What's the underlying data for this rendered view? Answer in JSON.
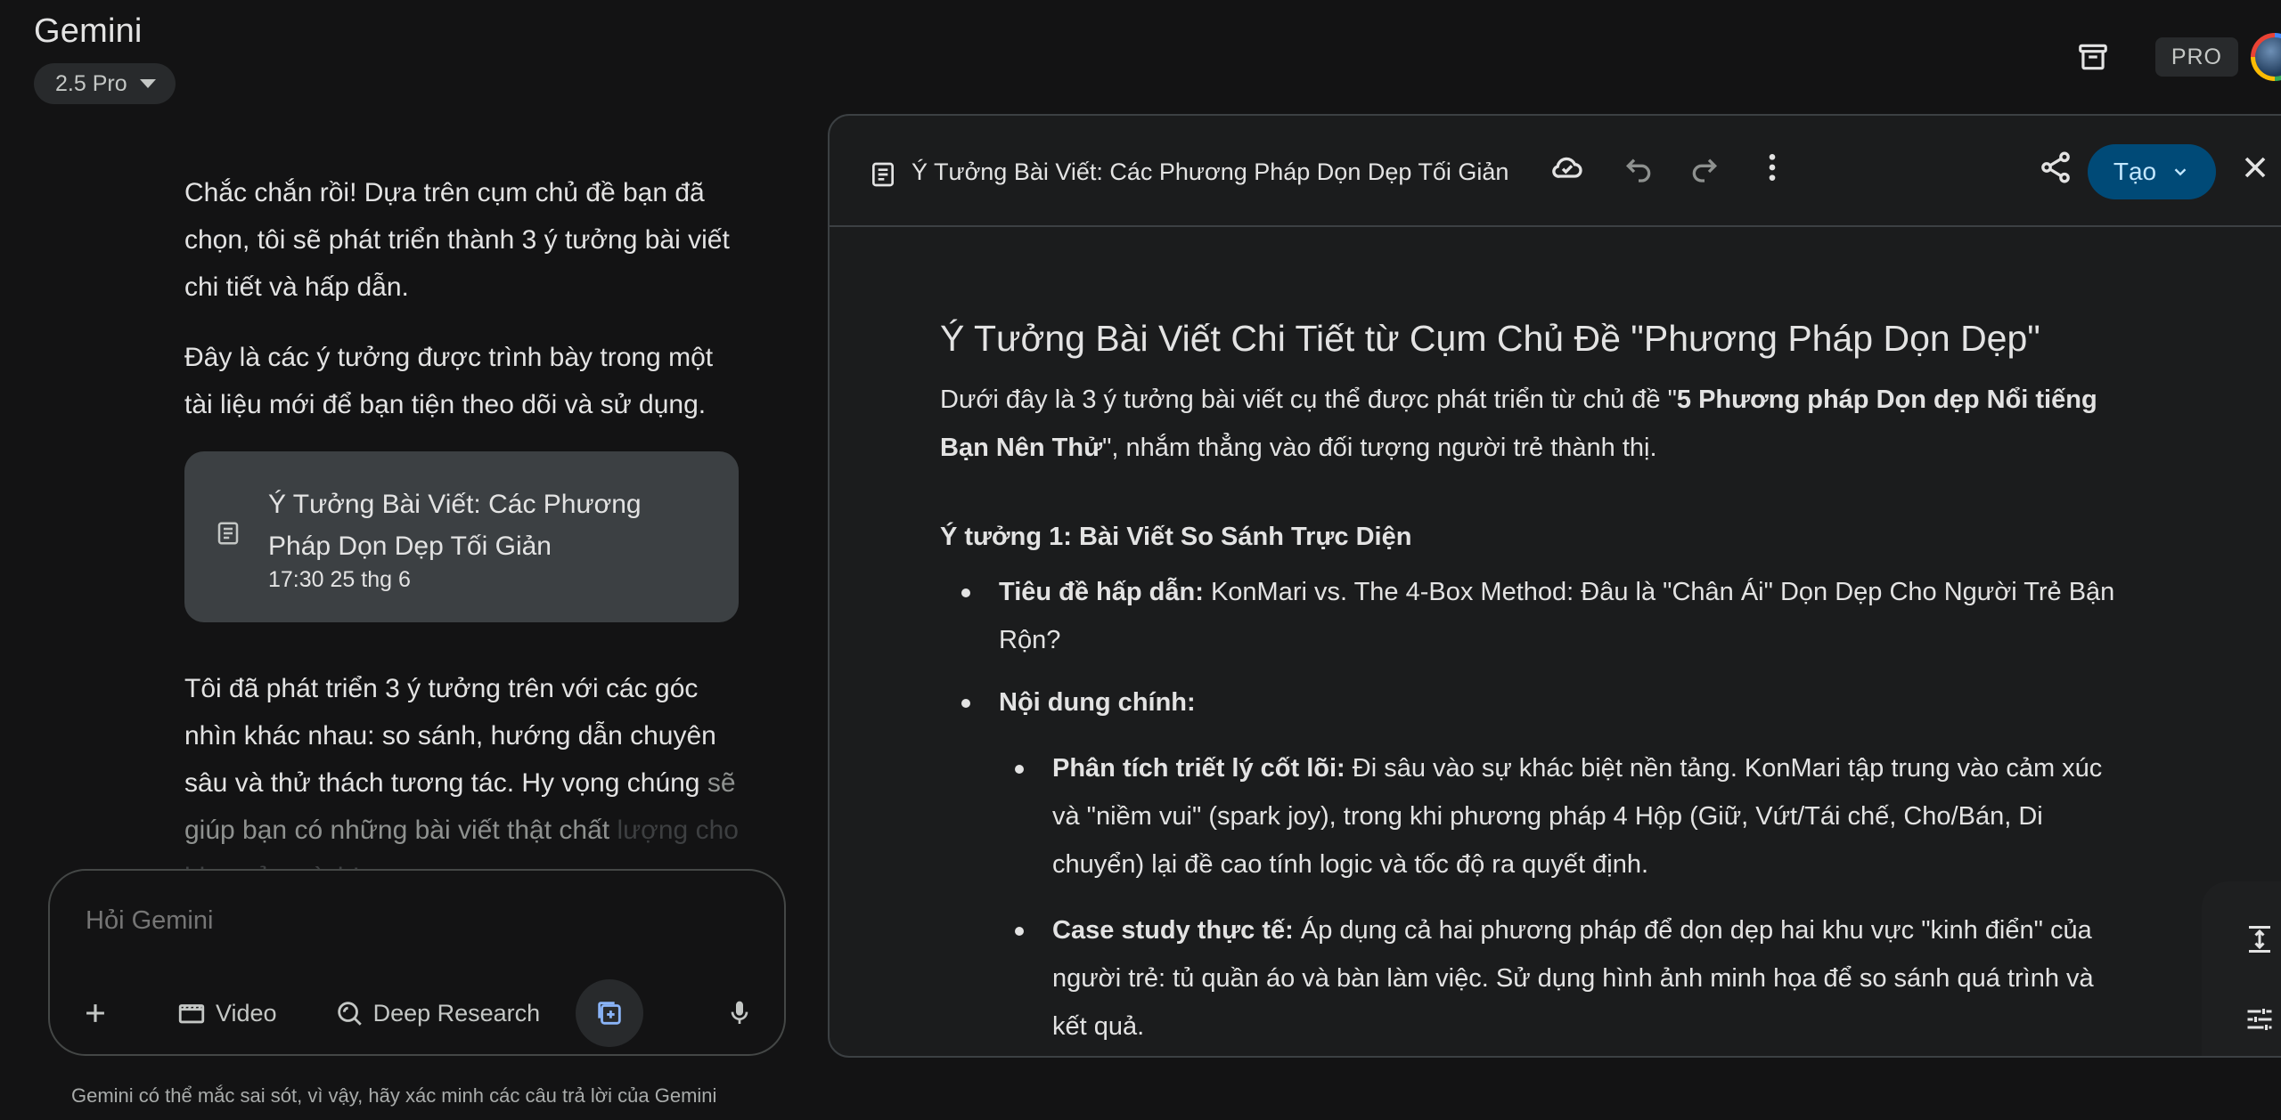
{
  "app": {
    "title": "Gemini"
  },
  "model": {
    "label": "2.5 Pro"
  },
  "header": {
    "pro_badge": "PRO"
  },
  "chat": {
    "para1": "Chắc chắn rồi! Dựa trên cụm chủ đề bạn đã chọn, tôi sẽ phát triển thành 3 ý tưởng bài viết chi tiết và hấp dẫn.",
    "para2": "Đây là các ý tưởng được trình bày trong một tài liệu mới để bạn tiện theo dõi và sử dụng.",
    "card_title": "Ý Tưởng Bài Viết: Các Phương Pháp Dọn Dẹp Tối Giản",
    "card_time": "17:30 25 thg 6",
    "para3": "Tôi đã phát triển 3 ý tưởng trên với các góc nhìn khác nhau: so sánh, hướng dẫn chuyên sâu và thử thách tương tác. Hy vọng chúng",
    "para3_fade": "sẽ giúp bạn có những bài viết thật chất",
    "para3_fade2": "lượng cho blog của mình!"
  },
  "prompt": {
    "placeholder": "Hỏi Gemini",
    "video_label": "Video",
    "deep_research_label": "Deep Research"
  },
  "disclaimer": "Gemini có thể mắc sai sót, vì vậy, hãy xác minh các câu trả lời của Gemini",
  "canvas": {
    "title": "Ý Tưởng Bài Viết: Các Phương Pháp Dọn Dẹp Tối Giản",
    "create_label": "Tạo",
    "doc": {
      "heading": "Ý Tưởng Bài Viết Chi Tiết từ Cụm Chủ Đề \"Phương Pháp Dọn Dẹp\"",
      "intro_pre": "Dưới đây là 3 ý tưởng bài viết cụ thể được phát triển từ chủ đề \"",
      "intro_bold": "5 Phương pháp Dọn dẹp Nổi tiếng Bạn Nên Thử",
      "intro_post": "\", nhắm thẳng vào đối tượng người trẻ thành thị.",
      "idea1_heading": "Ý tưởng 1: Bài Viết So Sánh Trực Diện",
      "item1_label": "Tiêu đề hấp dẫn:",
      "item1_text": " KonMari vs. The 4-Box Method: Đâu là \"Chân Ái\" Dọn Dẹp Cho Người Trẻ Bận Rộn?",
      "item2_label": "Nội dung chính:",
      "sub1_label": "Phân tích triết lý cốt lõi:",
      "sub1_text": " Đi sâu vào sự khác biệt nền tảng. KonMari tập trung vào cảm xúc và \"niềm vui\" (spark joy), trong khi phương pháp 4 Hộp (Giữ, Vứt/Tái chế, Cho/Bán, Di chuyển) lại đề cao tính logic và tốc độ ra quyết định.",
      "sub2_label": "Case study thực tế:",
      "sub2_text": " Áp dụng cả hai phương pháp để dọn dẹp hai khu vực \"kinh điển\" của người trẻ: tủ quần áo và bàn làm việc. Sử dụng hình ảnh minh họa để so sánh quá trình và kết quả."
    }
  },
  "icons": {
    "archive": "archive-icon",
    "document": "document-icon",
    "cloud": "cloud-done-icon",
    "undo": "undo-icon",
    "redo": "redo-icon",
    "more": "more-vert-icon",
    "share": "share-icon",
    "close": "close-icon",
    "plus": "plus-icon",
    "video": "video-icon",
    "deep_research": "deep-research-icon",
    "canvas": "canvas-icon",
    "mic": "mic-icon",
    "length": "vertical-align-icon",
    "tune": "tune-icon",
    "suggest": "suggest-edits-icon"
  },
  "colors": {
    "background": "#131314",
    "canvas_bg": "#1b1c1d",
    "card_bg": "#3c4043",
    "accent_button": "#004a77",
    "accent_text": "#c2e7ff"
  }
}
